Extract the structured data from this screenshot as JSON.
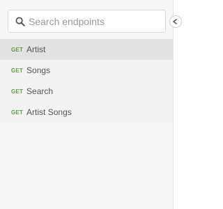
{
  "search": {
    "placeholder": "Search endpoints",
    "value": ""
  },
  "endpoints": [
    {
      "method": "GET",
      "label": "Artist",
      "active": true
    },
    {
      "method": "GET",
      "label": "Songs",
      "active": false
    },
    {
      "method": "GET",
      "label": "Search",
      "active": false
    },
    {
      "method": "GET",
      "label": "Artist Songs",
      "active": false
    }
  ],
  "colors": {
    "method_get": "#5e9c3f",
    "active_row": "#e2e2e2",
    "list_background": "#f3f3f3"
  },
  "icons": {
    "search": "search-icon",
    "toggle": "chevron-left-icon"
  }
}
